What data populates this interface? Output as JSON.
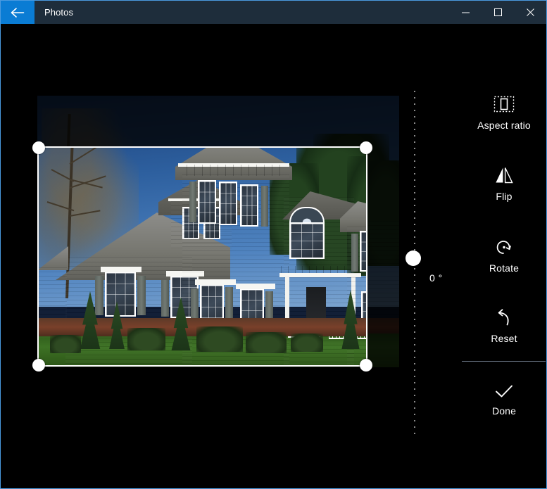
{
  "window": {
    "title": "Photos",
    "border_color": "#4a9ae0",
    "titlebar_bg": "#1e2d3b",
    "accent_color": "#0a7cd4",
    "canvas_bg": "#000000"
  },
  "titlebar": {
    "back_label": "Back",
    "back_icon": "arrow-left-icon",
    "title": "Photos",
    "minimize_label": "Minimize",
    "minimize_icon": "minimize-icon",
    "maximize_label": "Maximize",
    "maximize_icon": "maximize-icon",
    "close_label": "Close",
    "close_icon": "close-icon"
  },
  "editor": {
    "mode": "crop",
    "photo_alt": "Two-story white colonial house with gray shingle roof, blue sky and green lawn",
    "crop": {
      "handle_count": 4,
      "handles": [
        "top-left",
        "top-right",
        "bottom-left",
        "bottom-right"
      ],
      "border_color": "#ffffff"
    },
    "rotation": {
      "value": "0 °",
      "degrees": 0,
      "slider_orientation": "vertical",
      "thumb_position_percent": 50
    }
  },
  "tools": [
    {
      "id": "aspect-ratio",
      "label": "Aspect ratio",
      "icon": "aspect-ratio-icon"
    },
    {
      "id": "flip",
      "label": "Flip",
      "icon": "flip-icon"
    },
    {
      "id": "rotate",
      "label": "Rotate",
      "icon": "rotate-icon"
    },
    {
      "id": "reset",
      "label": "Reset",
      "icon": "reset-icon"
    },
    {
      "id": "done",
      "label": "Done",
      "icon": "checkmark-icon"
    }
  ]
}
